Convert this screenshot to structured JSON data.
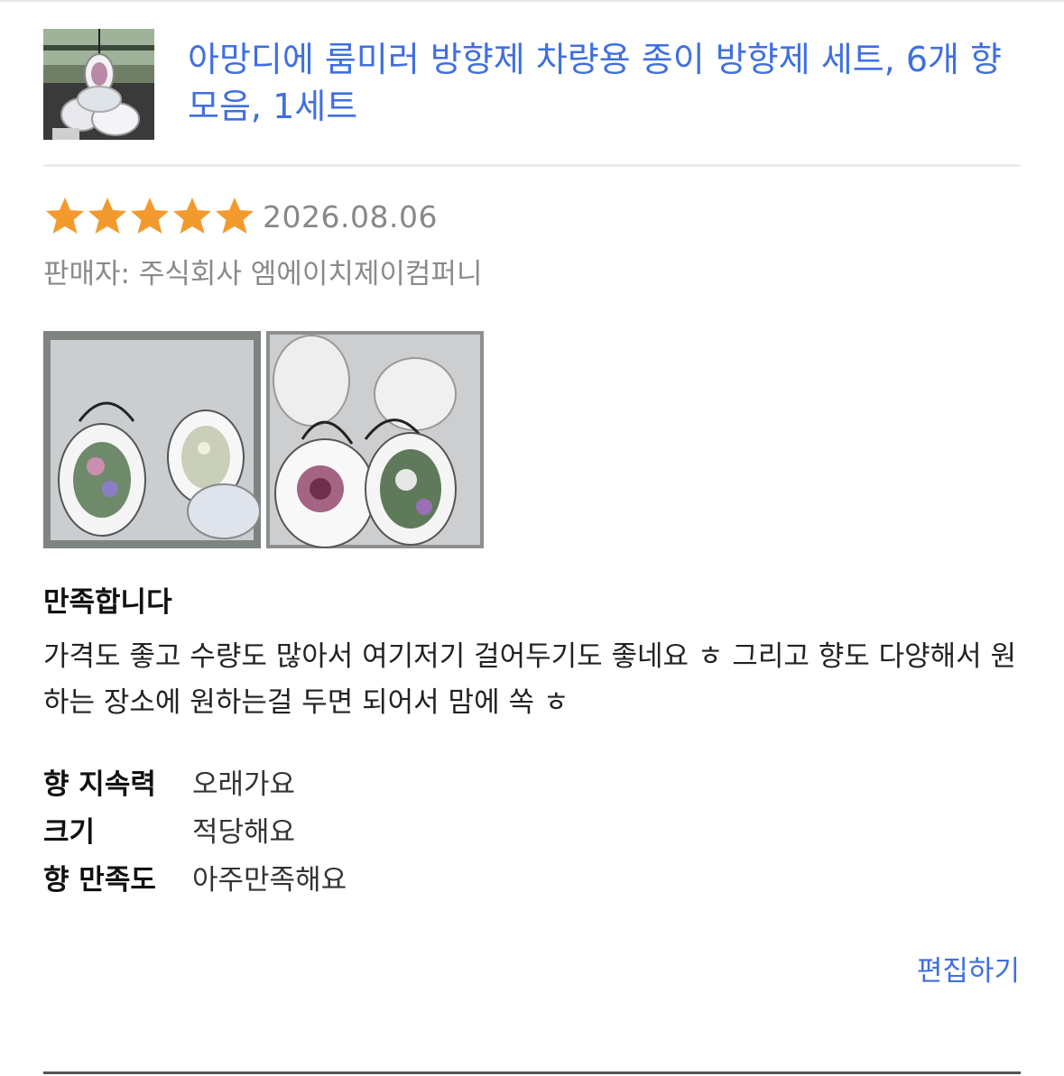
{
  "product": {
    "thumbnail_icon": "product-thumbnail",
    "title": "아망디에 룸미러 방향제 차량용 종이 방향제 세트, 6개 향 모음, 1세트",
    "link_color": "#3f6fe0"
  },
  "review": {
    "rating": 5,
    "rating_max": 5,
    "star_color": "#f39a2e",
    "date": "2026.08.06",
    "seller": "판매자: 주식회사 엠에이치제이컴퍼니",
    "photos": [
      "review-photo-1",
      "review-photo-2"
    ],
    "headline": "만족합니다",
    "body": "가격도 좋고 수량도 많아서 여기저기 걸어두기도 좋네요 ㅎ 그리고 향도 다양해서 원하는 장소에 원하는걸 두면 되어서 맘에 쏙 ㅎ",
    "survey": [
      {
        "question": "향 지속력",
        "answer": "오래가요"
      },
      {
        "question": "크기",
        "answer": "적당해요"
      },
      {
        "question": "향 만족도",
        "answer": "아주만족해요"
      }
    ]
  },
  "actions": {
    "edit_label": "편집하기"
  }
}
